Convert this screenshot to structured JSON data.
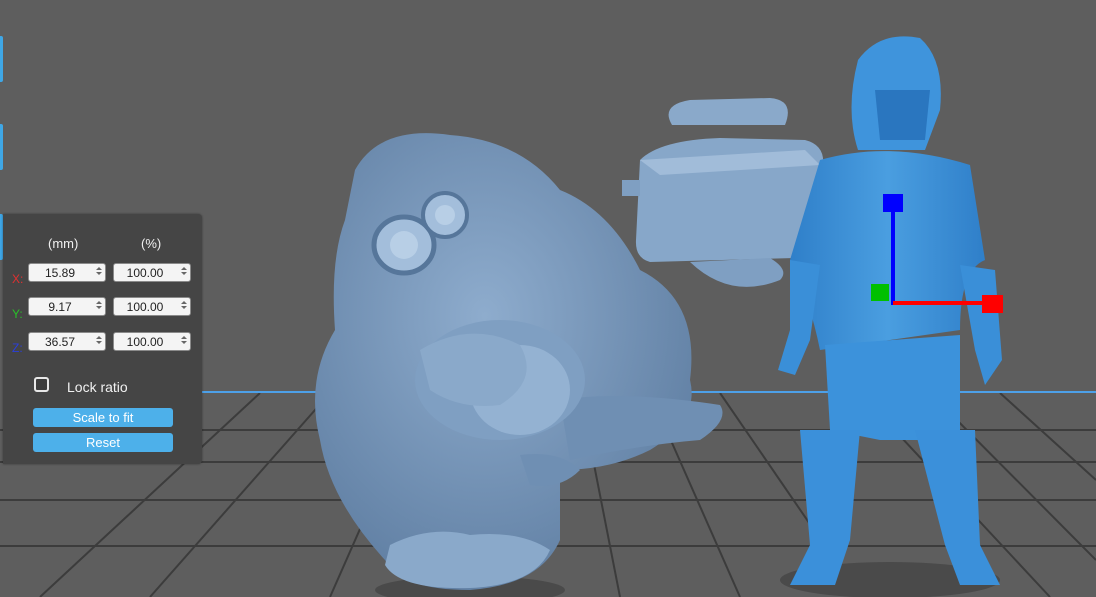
{
  "scale_panel": {
    "col_mm": "(mm)",
    "col_pct": "(%)",
    "rows": [
      {
        "axis": "X:",
        "axis_color": "#e03030",
        "mm": "15.89",
        "pct": "100.00"
      },
      {
        "axis": "Y:",
        "axis_color": "#28c028",
        "mm": "9.17",
        "pct": "100.00"
      },
      {
        "axis": "Z:",
        "axis_color": "#2a3fdc",
        "mm": "36.57",
        "pct": "100.00"
      }
    ],
    "lock_ratio_label": "Lock ratio",
    "lock_ratio_checked": false,
    "scale_to_fit_label": "Scale to fit",
    "reset_label": "Reset"
  },
  "colors": {
    "background": "#5e5e5e",
    "grid_line": "#3c3c3c",
    "grid_axis": "#4da0e8",
    "model_unselected": "#7f9fc2",
    "model_selected": "#3d92dc",
    "accent": "#4db0ea",
    "gizmo_x": "#ff0000",
    "gizmo_y": "#00c000",
    "gizmo_z": "#0000ff"
  },
  "icons": [
    "move-gizmo-icon",
    "checkbox-icon"
  ]
}
